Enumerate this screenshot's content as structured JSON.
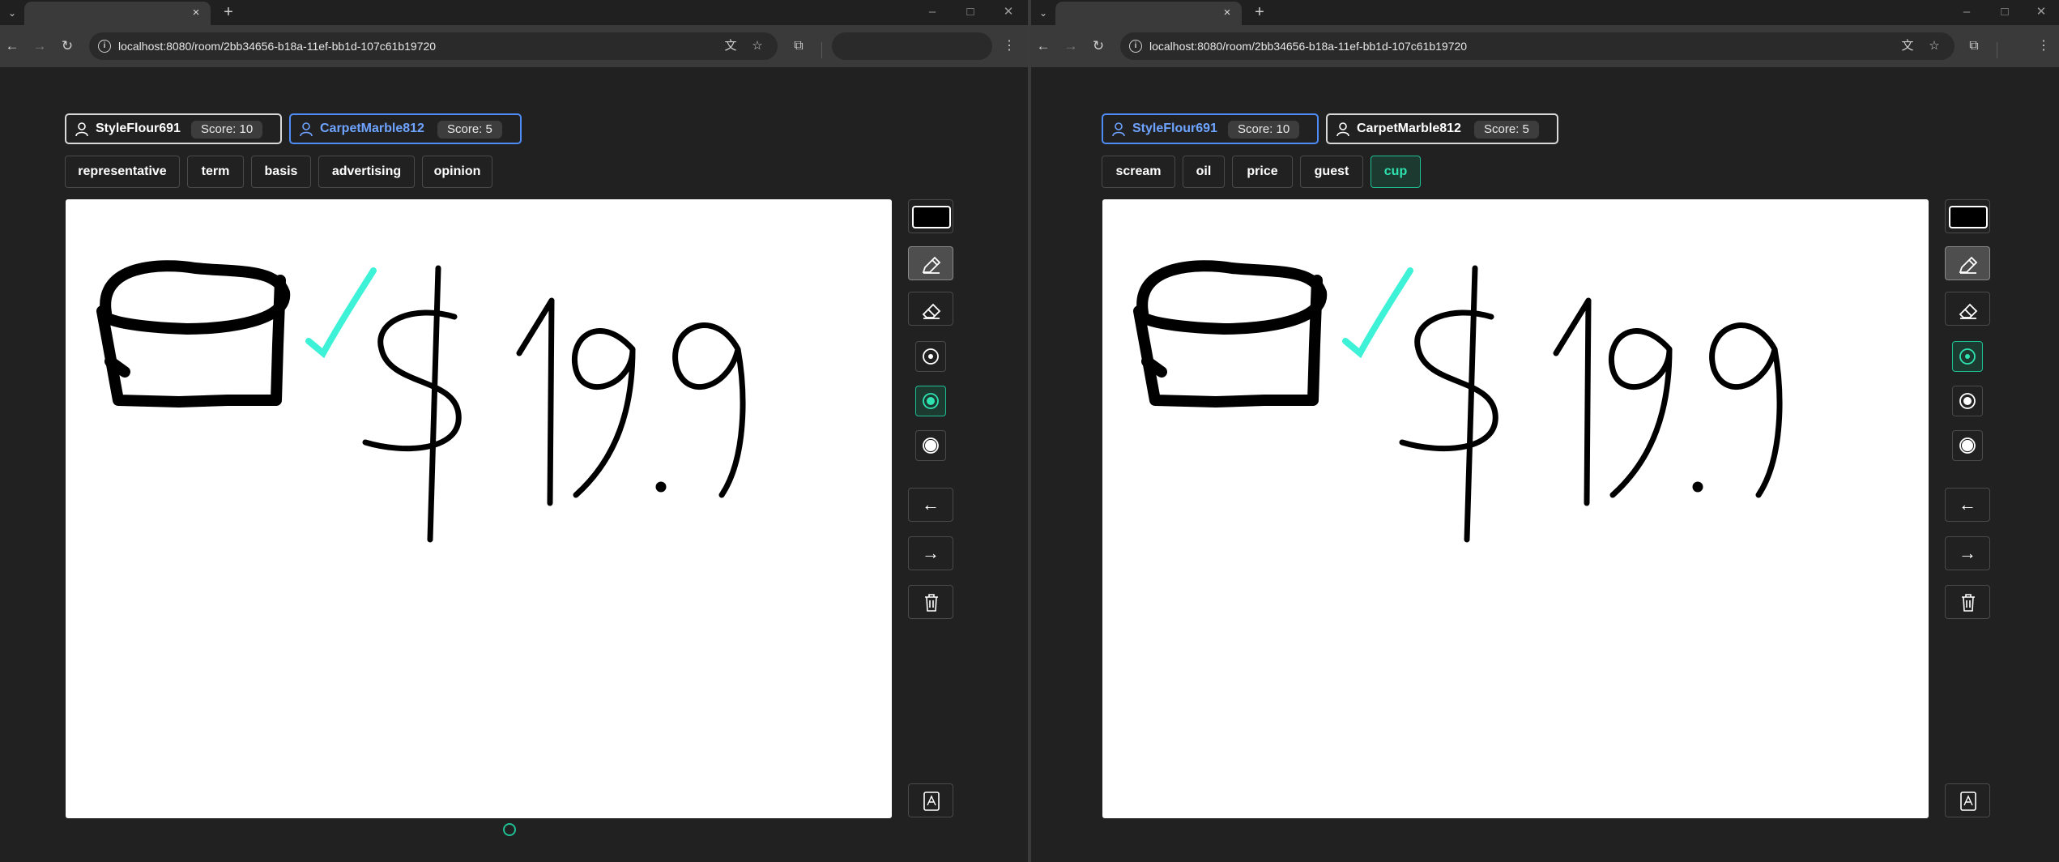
{
  "browser": {
    "url": "localhost:8080/room/2bb34656-b18a-11ef-bb1d-107c61b19720"
  },
  "colors": {
    "accent": "#1fbf94",
    "active_player": "#4e8df5",
    "stroke_cyan": "#3ef2d8",
    "stroke_black": "#000000"
  },
  "left": {
    "players": [
      {
        "name": "StyleFlour691",
        "score": "Score: 10"
      },
      {
        "name": "CarpetMarble812",
        "score": "Score: 5"
      }
    ],
    "words": [
      "representative",
      "term",
      "basis",
      "advertising",
      "opinion"
    ]
  },
  "right": {
    "players": [
      {
        "name": "StyleFlour691",
        "score": "Score: 10"
      },
      {
        "name": "CarpetMarble812",
        "score": "Score: 5"
      }
    ],
    "words": [
      "scream",
      "oil",
      "price",
      "guest",
      "cup"
    ]
  },
  "tools": {
    "undo_glyph": "←",
    "redo_glyph": "→"
  },
  "icons": {
    "tab_dropdown": "chevron-down-icon",
    "close": "close-icon",
    "new_tab": "plus-icon",
    "back": "back-arrow-icon",
    "forward": "forward-arrow-icon",
    "reload": "reload-icon",
    "translate": "translate-icon",
    "bookmark": "star-icon",
    "extensions": "puzzle-icon",
    "menu": "kebab-menu-icon",
    "user": "user-icon",
    "color": "color-swatch-icon",
    "pen": "pen-icon",
    "eraser": "eraser-icon",
    "size": "brush-size-icon",
    "undo": "undo-icon",
    "redo": "redo-icon",
    "clear": "trash-icon",
    "submit": "submit-icon"
  }
}
